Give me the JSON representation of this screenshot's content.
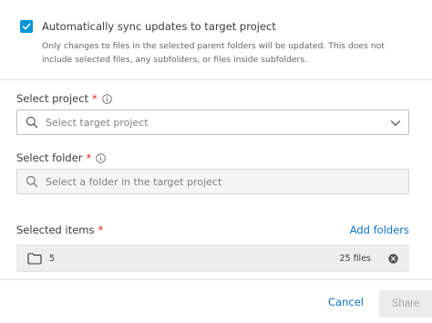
{
  "sync": {
    "checked": true,
    "label": "Automatically sync updates to target project",
    "note": "Only changes to files in the selected parent folders will be updated. This does not include selected files, any subfolders, or files inside subfolders."
  },
  "select_project": {
    "label": "Select project",
    "required_mark": "*",
    "placeholder": "Select target project"
  },
  "select_folder": {
    "label": "Select folder",
    "required_mark": "*",
    "placeholder": "Select a folder in the target project"
  },
  "selected_items": {
    "label": "Selected items",
    "required_mark": "*",
    "add_label": "Add folders",
    "items": [
      {
        "name": "5",
        "count": "25 files"
      }
    ]
  },
  "footer": {
    "cancel_label": "Cancel",
    "share_label": "Share"
  },
  "colors": {
    "accent": "#0696d7",
    "link": "#0a74c4",
    "required": "#dd2222"
  }
}
